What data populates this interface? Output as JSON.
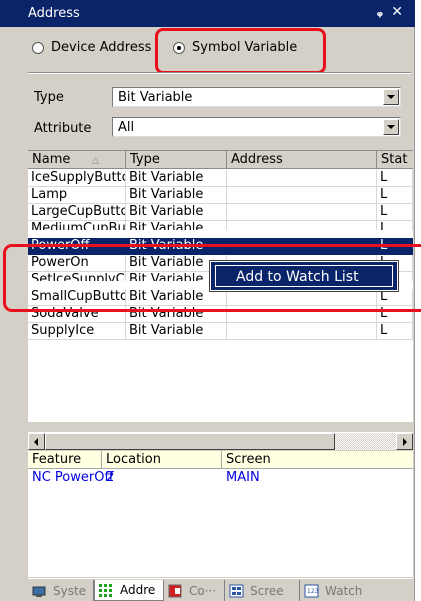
{
  "window": {
    "title": "Address",
    "pin_glyph": "ᵩ",
    "close_glyph": "✕"
  },
  "mode": {
    "options": [
      {
        "label": "Device Address",
        "selected": false
      },
      {
        "label": "Symbol Variable",
        "selected": true
      }
    ]
  },
  "filters": {
    "type_label": "Type",
    "type_value": "Bit Variable",
    "attribute_label": "Attribute",
    "attribute_value": "All"
  },
  "table": {
    "columns": [
      "Name",
      "Type",
      "Address",
      "Stat"
    ],
    "rows": [
      {
        "name": "IceSupplyButtc",
        "type": "Bit Variable",
        "address": "",
        "stat": "L"
      },
      {
        "name": "Lamp",
        "type": "Bit Variable",
        "address": "",
        "stat": "L"
      },
      {
        "name": "LargeCupButto",
        "type": "Bit Variable",
        "address": "",
        "stat": "L"
      },
      {
        "name": "MediumCupBut",
        "type": "Bit Variable",
        "address": "",
        "stat": "L"
      },
      {
        "name": "PowerOff",
        "type": "Bit Variable",
        "address": "",
        "stat": "L",
        "selected": true
      },
      {
        "name": "PowerOn",
        "type": "Bit Variable",
        "address": "",
        "stat": "L"
      },
      {
        "name": "SetIceSupplyC",
        "type": "Bit Variable",
        "address": "",
        "stat": "L"
      },
      {
        "name": "SmallCupButto",
        "type": "Bit Variable",
        "address": "",
        "stat": "L"
      },
      {
        "name": "SodaValve",
        "type": "Bit Variable",
        "address": "",
        "stat": "L"
      },
      {
        "name": "SupplyIce",
        "type": "Bit Variable",
        "address": "",
        "stat": "L"
      }
    ]
  },
  "context_menu": {
    "item": "Add to Watch List"
  },
  "cross_ref": {
    "columns": [
      "Feature",
      "Location",
      "Screen"
    ],
    "rows": [
      {
        "feature": "NC PowerOff",
        "location": "2",
        "screen": "MAIN"
      }
    ]
  },
  "tabs": [
    {
      "label": "Syste",
      "icon": "system-icon",
      "active": false
    },
    {
      "label": "Addre",
      "icon": "address-icon",
      "active": true
    },
    {
      "label": "Co···",
      "icon": "common-icon",
      "active": false
    },
    {
      "label": "Scree",
      "icon": "screen-icon",
      "active": false
    },
    {
      "label": "Watch",
      "icon": "watch-icon",
      "active": false
    }
  ],
  "colors": {
    "titlebar": "#0a246a",
    "selection": "#0a246a",
    "highlight_outline": "#e8101c",
    "xref_text": "#0000e0",
    "xref_header": "#ffffe1"
  }
}
